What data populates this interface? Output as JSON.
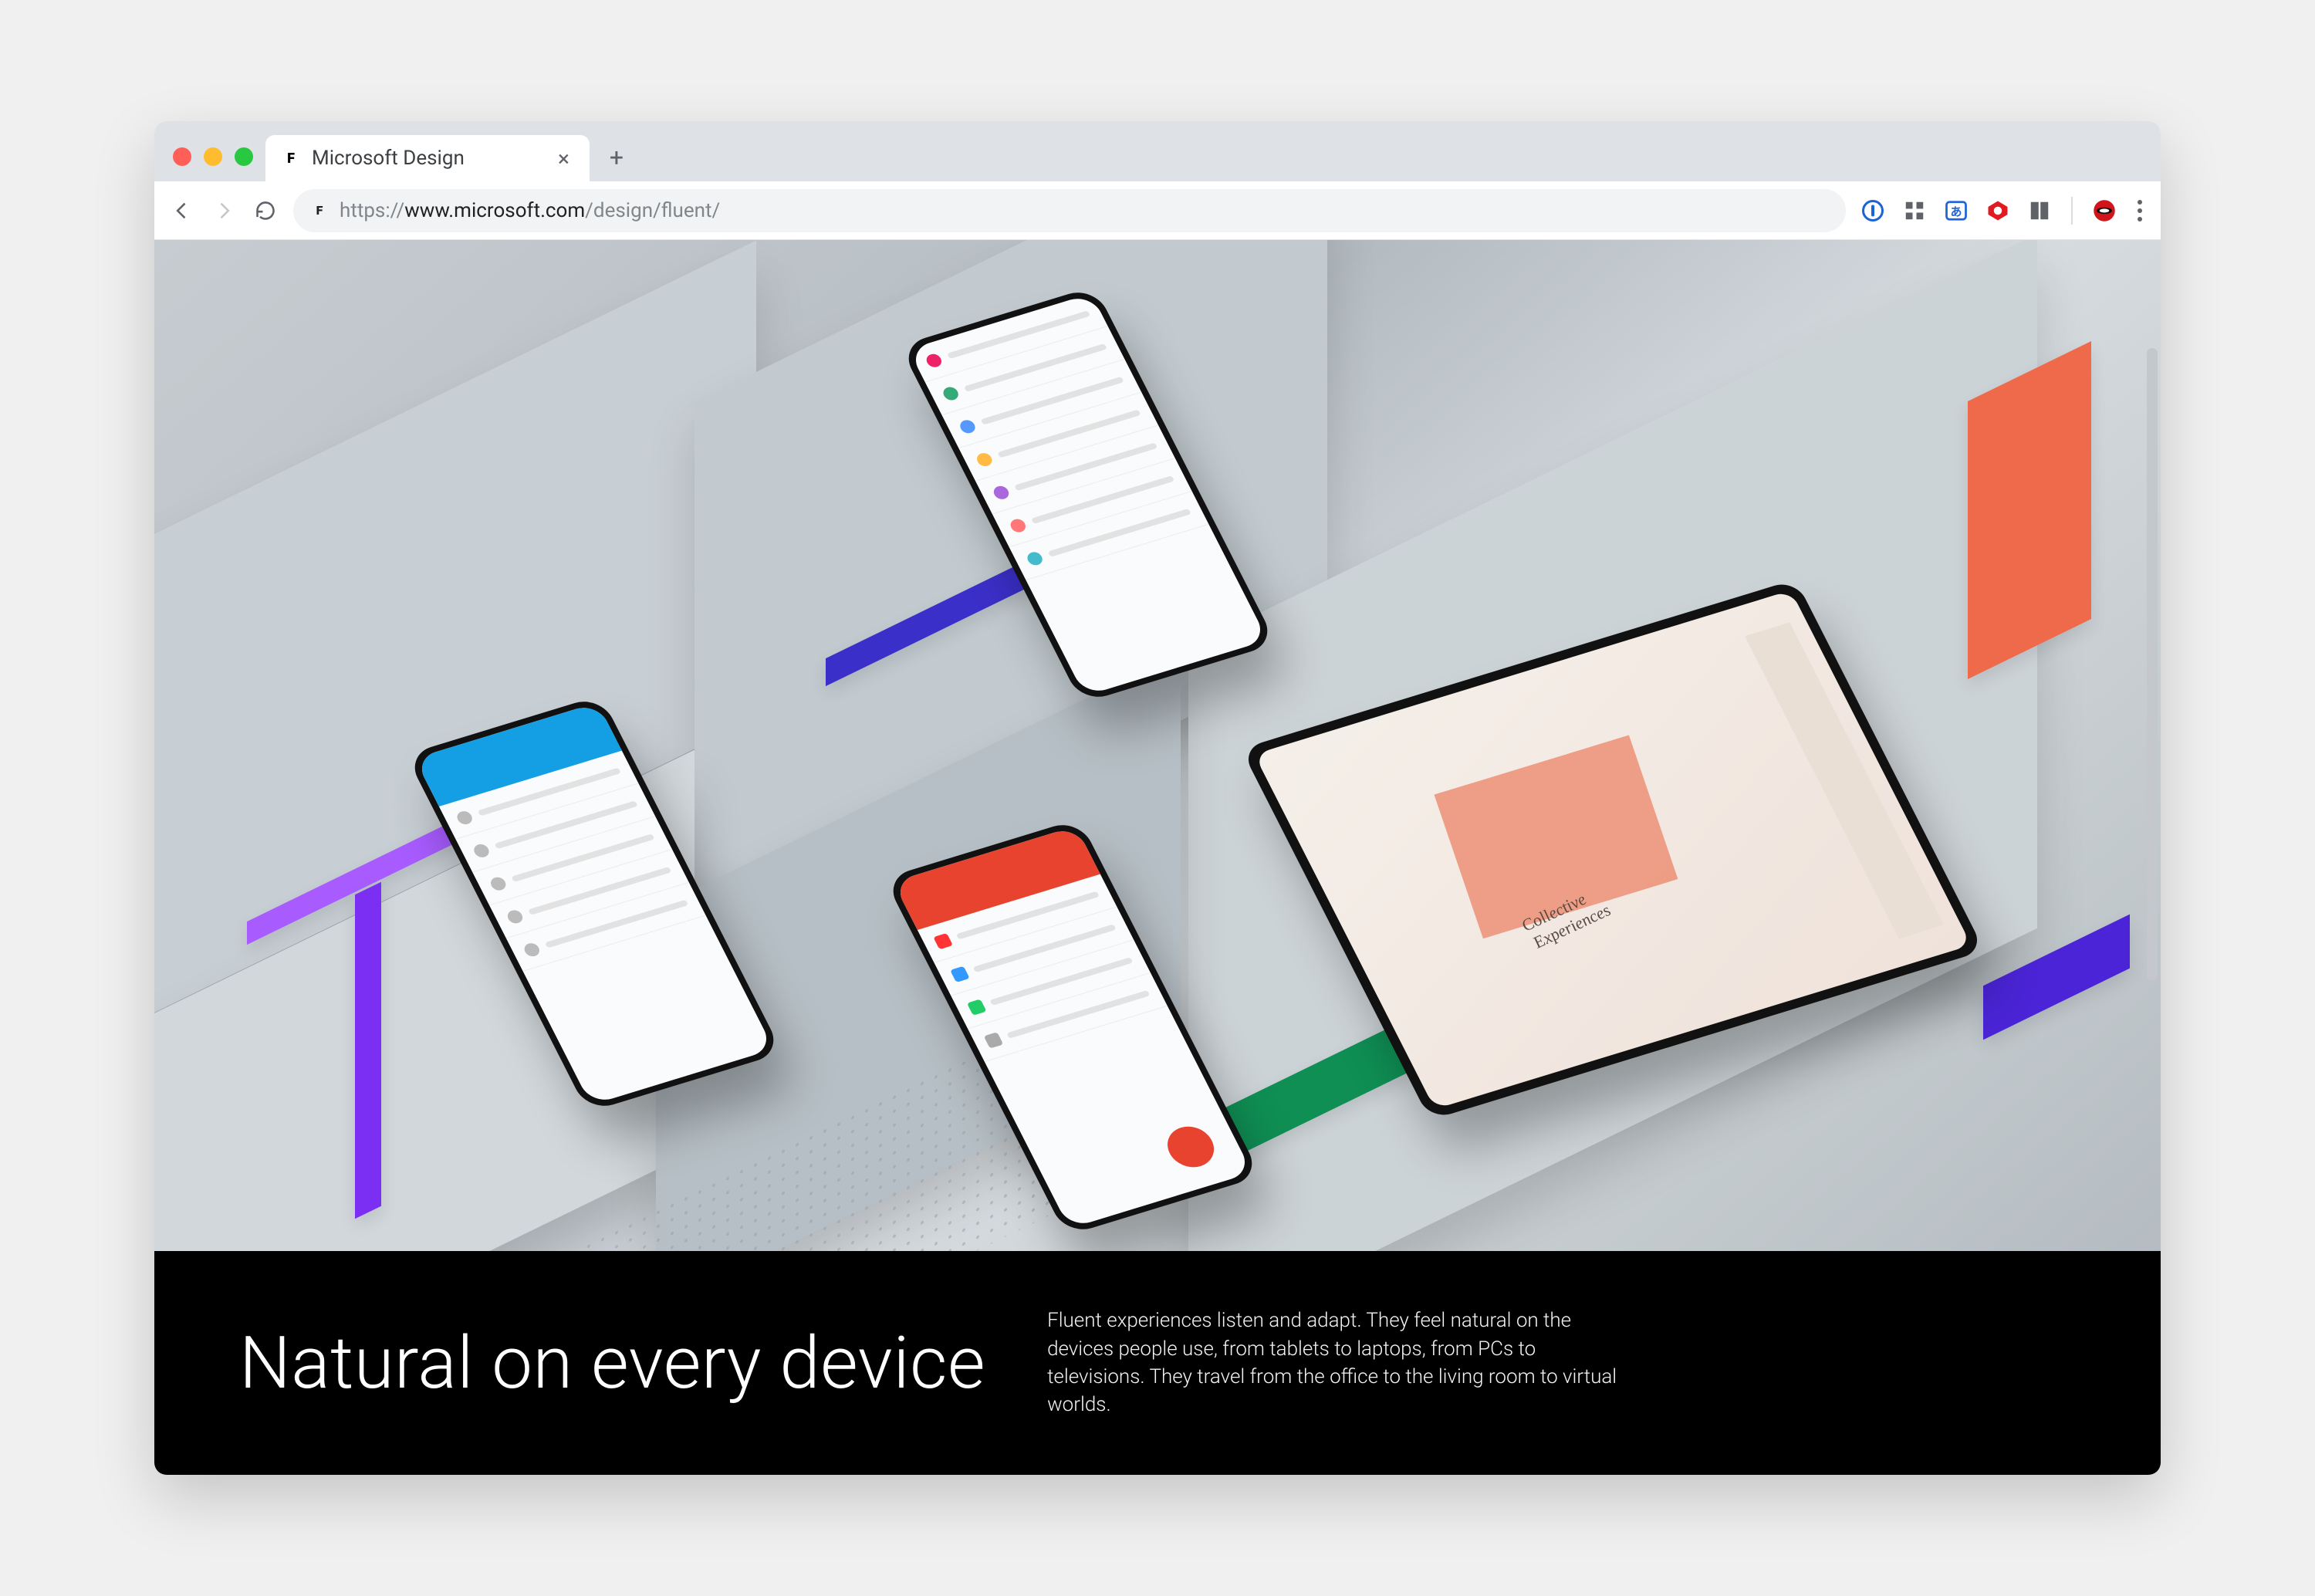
{
  "browser": {
    "tab_title": "Microsoft Design",
    "url_prefix": "https://",
    "url_host": "www.microsoft.com",
    "url_path": "/design/fluent/"
  },
  "page": {
    "headline": "Natural on every device",
    "body": "Fluent experiences listen and adapt. They feel natural on the devices people use, from tablets to laptops, from PCs to televisions. They travel from the office to the living room to virtual worlds.",
    "tablet_caption_line1": "Collective",
    "tablet_caption_line2": "Experiences"
  },
  "colors": {
    "accent_purple": "#7b2ff2",
    "accent_indigo": "#3b2fc9",
    "accent_orange": "#ef6a4b",
    "accent_green": "#0f8f54",
    "phone_blue": "#149fe4",
    "phone_red": "#e8432e"
  }
}
